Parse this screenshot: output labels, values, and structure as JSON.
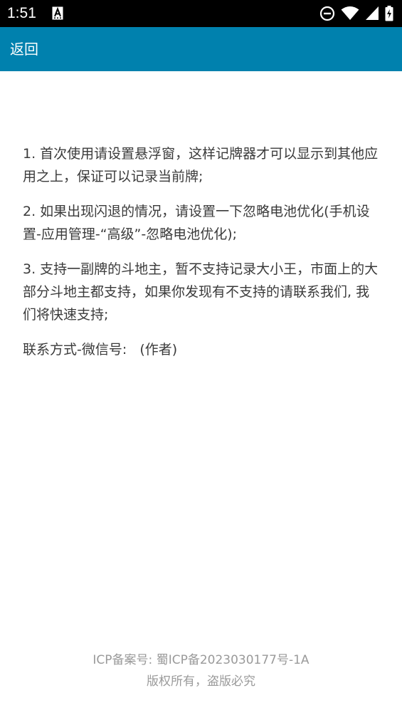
{
  "status_bar": {
    "time": "1:51",
    "icons": [
      "notification-a-icon",
      "do-not-disturb-icon",
      "wifi-icon",
      "cell-signal-icon",
      "battery-charging-icon"
    ]
  },
  "app_bar": {
    "back_label": "返回",
    "background": "#0081ae"
  },
  "instructions": [
    "1. 首次使用请设置悬浮窗，这样记牌器才可以显示到其他应用之上，保证可以记录当前牌;",
    "2. 如果出现闪退的情况，请设置一下忽略电池优化(手机设置-应用管理-“高级”-忽略电池优化);",
    "3. 支持一副牌的斗地主，暂不支持记录大小王，市面上的大部分斗地主都支持，如果你发现有不支持的请联系我们, 我们将快速支持;",
    "联系方式-微信号:   (作者)"
  ],
  "footer": {
    "icp": "ICP备案号: 蜀ICP备2023030177号-1A",
    "copyright": "版权所有，盗版必究"
  }
}
